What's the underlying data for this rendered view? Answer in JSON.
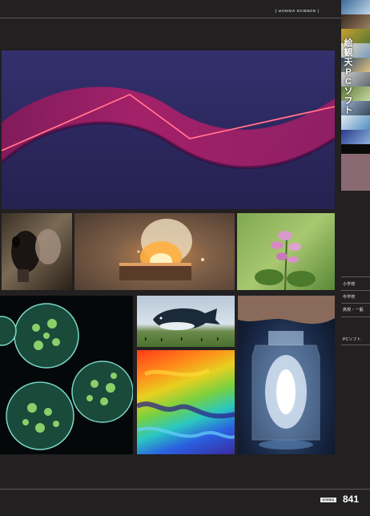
{
  "header": {
    "brand": "UCHIDA SCIENCE",
    "divider_left": "|",
    "divider_right": "|"
  },
  "sidebar": {
    "categories": [
      {
        "label": "小学校"
      },
      {
        "label": "中学校"
      },
      {
        "label": "高校・一般"
      },
      {
        "label": "PCソフト"
      }
    ],
    "thumb_strip_text": [
      "絵",
      "観",
      "天",
      "P",
      "C",
      "ソ",
      "フ",
      "ト"
    ]
  },
  "photos": [
    {
      "name": "laser-wave-photo"
    },
    {
      "name": "gas-mask-photo"
    },
    {
      "name": "burning-block-photo"
    },
    {
      "name": "pink-flower-photo"
    },
    {
      "name": "volvox-microscope-photo"
    },
    {
      "name": "whale-balloon-photo"
    },
    {
      "name": "thermal-map-photo"
    },
    {
      "name": "glowing-bottle-photo"
    }
  ],
  "footer": {
    "logo_text": "UCHIDA",
    "page_number": "841"
  },
  "colors": {
    "background": "#222021",
    "accent_tab": "#8a6a72",
    "rule": "#5b5859"
  }
}
